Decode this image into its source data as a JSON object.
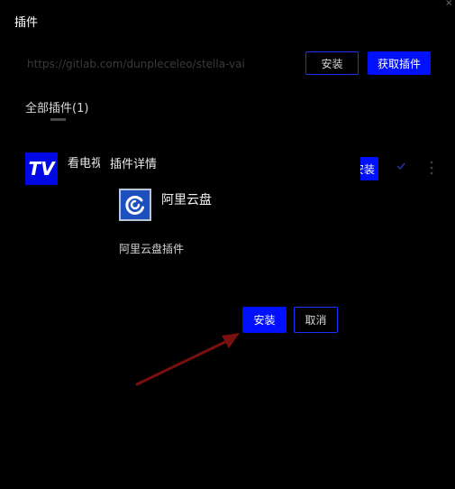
{
  "window": {
    "title": "插件",
    "close_glyph": "×"
  },
  "url_bar": {
    "value": "https://gitlab.com/dunpleceleo/stella-vai"
  },
  "toolbar": {
    "install_label": "安装",
    "get_plugins_label": "获取插件"
  },
  "tabs": [
    {
      "label": "全部插件(1)",
      "active": true
    }
  ],
  "plugin_list": [
    {
      "name": "看电视",
      "logo_text": "TV",
      "action_label": "安装"
    }
  ],
  "dialog": {
    "title": "插件详情",
    "plugin_name": "阿里云盘",
    "description": "阿里云盘插件",
    "install_label": "安装",
    "cancel_label": "取消"
  },
  "icons": {
    "tv_logo": "tv-logo-icon",
    "plugin_logo": "aliyun-drive-icon",
    "check": "check-icon",
    "more": "more-vertical-icon"
  },
  "colors": {
    "background": "#000000",
    "accent": "#0010ff",
    "arrow": "#7a0f0f"
  }
}
